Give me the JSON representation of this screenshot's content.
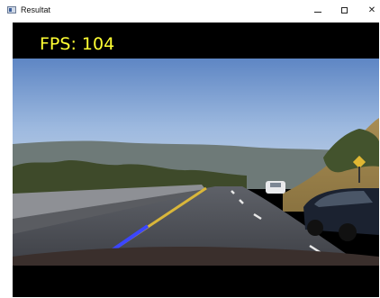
{
  "window": {
    "title": "Resultat",
    "controls": {
      "minimize": "minimize-icon",
      "maximize": "maximize-icon",
      "close": "close-icon"
    }
  },
  "overlay": {
    "fps_text": "FPS: 104",
    "fps_color": "#ffff33"
  },
  "scene": {
    "description_icon": "road-video-frame",
    "lane_line_color": "#3b46ff",
    "lane_left_marking_color": "#e6c23a"
  }
}
